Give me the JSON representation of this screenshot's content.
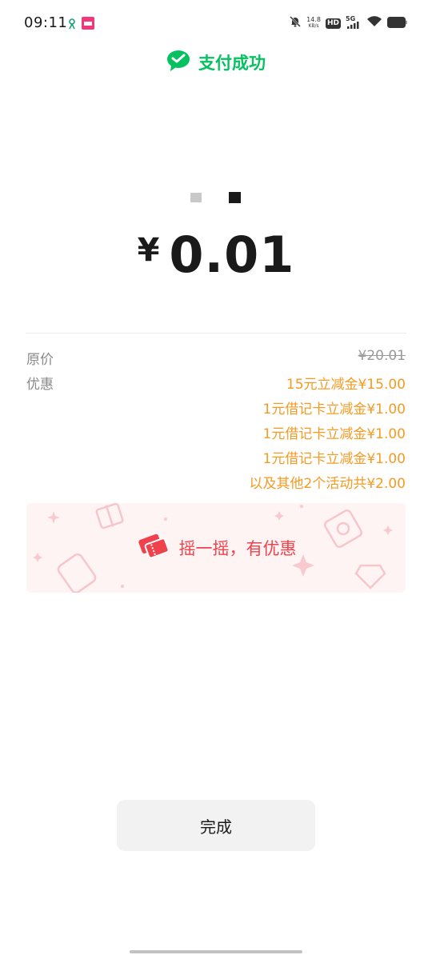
{
  "status_bar": {
    "time": "09:11",
    "net_speed_value": "14.8",
    "net_speed_unit": "KB/s",
    "hd": "HD",
    "network": "5G"
  },
  "header": {
    "title": "支付成功",
    "brand_color": "#07c160",
    "icon": "wechat-pay-icon"
  },
  "payment": {
    "currency": "¥",
    "amount": "0.01"
  },
  "details": {
    "original_label": "原价",
    "original_value": "¥20.01",
    "discount_label": "优惠",
    "discounts": [
      "15元立减金¥15.00",
      "1元借记卡立减金¥1.00",
      "1元借记卡立减金¥1.00",
      "1元借记卡立减金¥1.00",
      "以及其他2个活动共¥2.00"
    ],
    "discount_color": "#f59a23"
  },
  "banner": {
    "label": "摇一摇，有优惠",
    "icon": "shake-ticket-icon",
    "color": "#f0424d"
  },
  "actions": {
    "done_label": "完成"
  }
}
